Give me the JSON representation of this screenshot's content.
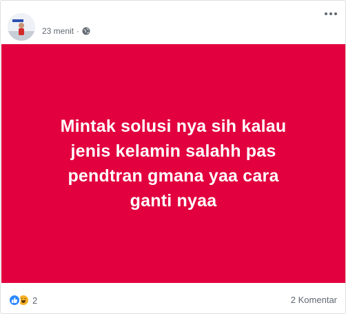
{
  "post": {
    "timestamp": "23 menit",
    "separator": "·",
    "privacy_icon": "globe-icon",
    "options_icon": "more-options-icon",
    "text_lines": [
      "Mintak solusi nya sih kalau",
      "jenis kelamin salahh pas",
      "pendtran gmana yaa cara",
      "ganti nyaa"
    ],
    "background_color": "#e2003f",
    "text_color": "#ffffff"
  },
  "footer": {
    "reaction_icons": [
      "like-icon",
      "haha-icon"
    ],
    "reaction_count": "2",
    "comments_label": "2 Komentar"
  }
}
